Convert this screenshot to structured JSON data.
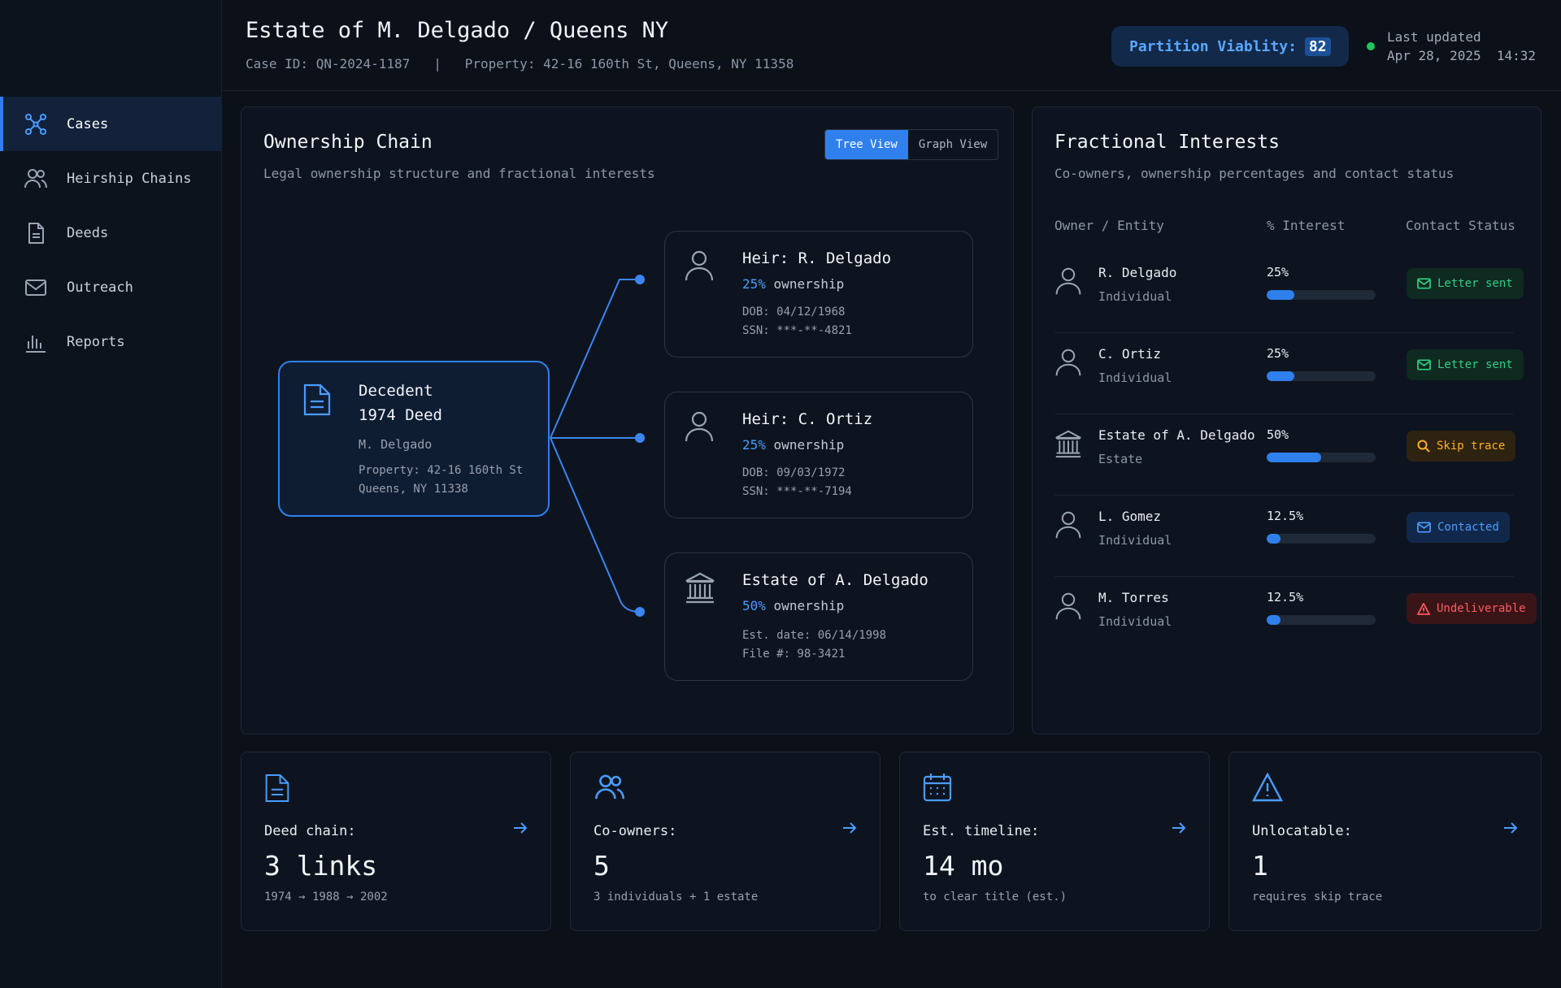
{
  "sidebar": {
    "items": [
      {
        "label": "Cases",
        "icon": "network-icon",
        "active": true
      },
      {
        "label": "Heirship Chains",
        "icon": "users-icon"
      },
      {
        "label": "Deeds",
        "icon": "document-icon"
      },
      {
        "label": "Outreach",
        "icon": "mail-icon"
      },
      {
        "label": "Reports",
        "icon": "bar-chart-icon"
      }
    ]
  },
  "header": {
    "title": "Estate of M. Delgado / Queens NY",
    "case_id": "Case ID: QN-2024-1187",
    "separator": "|",
    "property": "Property: 42-16 160th St, Queens, NY 11358",
    "viability_label": "Partition Viablity:",
    "viability_value": "82",
    "updated_label": "Last updated",
    "updated_value": "Apr 28, 2025  14:32"
  },
  "ownership": {
    "title": "Ownership Chain",
    "subtitle": "Legal ownership structure and fractional interests",
    "view_tree": "Tree View",
    "view_graph": "Graph View",
    "decedent": {
      "title": "Decedent",
      "deed": "1974 Deed",
      "name": "M. Delgado",
      "property_line1": "Property: 42-16 160th St",
      "property_line2": "Queens, NY 11338"
    },
    "heirs": [
      {
        "title": "Heir: R. Delgado",
        "pct": "25%",
        "suffix": "ownership",
        "line1": "DOB: 04/12/1968",
        "line2": "SSN: ***-**-4821"
      },
      {
        "title": "Heir: C. Ortiz",
        "pct": "25%",
        "suffix": "ownership",
        "line1": "DOB: 09/03/1972",
        "line2": "SSN: ***-**-7194"
      },
      {
        "title": "Estate of A. Delgado",
        "pct": "50%",
        "suffix": "ownership",
        "line1": "Est. date: 06/14/1998",
        "line2": "File #: 98-3421"
      }
    ]
  },
  "interests": {
    "title": "Fractional Interests",
    "subtitle": "Co-owners, ownership percentages and contact status",
    "col_owner": "Owner / Entity",
    "col_interest": "% Interest",
    "col_status": "Contact Status",
    "rows": [
      {
        "name": "R. Delgado",
        "type": "Individual",
        "pct": "25%",
        "fill": 0.25,
        "status": "Letter sent",
        "tone": "green"
      },
      {
        "name": "C. Ortiz",
        "type": "Individual",
        "pct": "25%",
        "fill": 0.25,
        "status": "Letter sent",
        "tone": "green"
      },
      {
        "name": "Estate of A. Delgado",
        "type": "Estate",
        "pct": "50%",
        "fill": 0.5,
        "status": "Skip trace",
        "tone": "orange"
      },
      {
        "name": "L. Gomez",
        "type": "Individual",
        "pct": "12.5%",
        "fill": 0.125,
        "status": "Contacted",
        "tone": "blue"
      },
      {
        "name": "M. Torres",
        "type": "Individual",
        "pct": "12.5%",
        "fill": 0.125,
        "status": "Undeliverable",
        "tone": "red"
      }
    ]
  },
  "summary": [
    {
      "label": "Deed chain:",
      "value": "3 links",
      "desc": "1974 → 1988 → 2002",
      "icon": "document-icon"
    },
    {
      "label": "Co-owners:",
      "value": "5",
      "desc": "3 individuals + 1 estate",
      "icon": "users-icon"
    },
    {
      "label": "Est. timeline:",
      "value": "14 mo",
      "desc": "to clear title (est.)",
      "icon": "calendar-icon"
    },
    {
      "label": "Unlocatable:",
      "value": "1",
      "desc": "requires skip trace",
      "icon": "warning-icon"
    }
  ],
  "colors": {
    "accent": "#2f80ed",
    "green": "#2fd184",
    "orange": "#ffb020",
    "red": "#ff5a5f"
  }
}
